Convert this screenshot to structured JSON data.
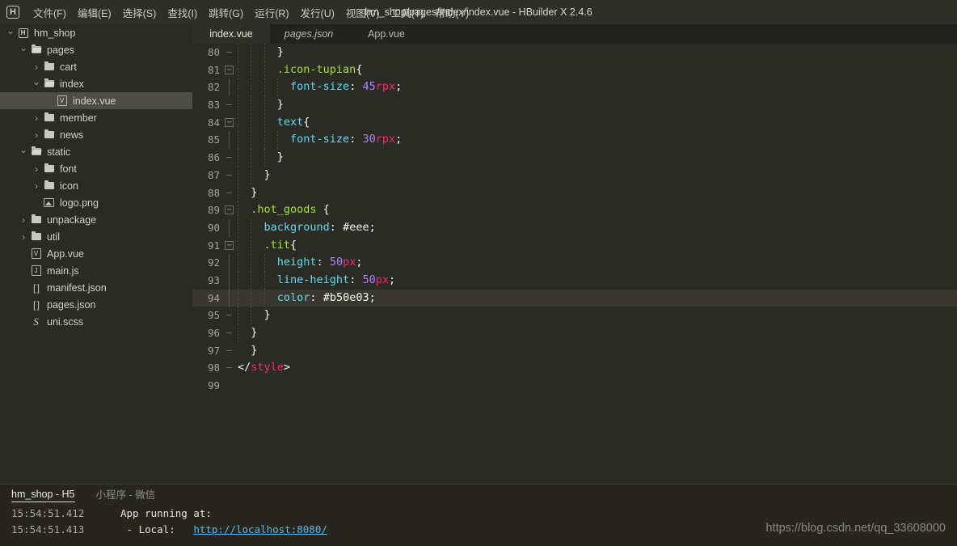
{
  "window": {
    "title": "hm_shop/pages/index/index.vue - HBuilder X 2.4.6",
    "logo": "H"
  },
  "menubar": {
    "items": [
      {
        "label": "文件(F)",
        "name": "menu-file"
      },
      {
        "label": "编辑(E)",
        "name": "menu-edit"
      },
      {
        "label": "选择(S)",
        "name": "menu-select"
      },
      {
        "label": "查找(I)",
        "name": "menu-find"
      },
      {
        "label": "跳转(G)",
        "name": "menu-goto"
      },
      {
        "label": "运行(R)",
        "name": "menu-run"
      },
      {
        "label": "发行(U)",
        "name": "menu-publish"
      },
      {
        "label": "视图(V)",
        "name": "menu-view"
      },
      {
        "label": "工具(T)",
        "name": "menu-tools"
      },
      {
        "label": "帮助(Y)",
        "name": "menu-help"
      }
    ]
  },
  "sidebar": {
    "items": [
      {
        "label": "hm_shop",
        "depth": 0,
        "twisty": "open",
        "icon": "project-icon",
        "selected": false
      },
      {
        "label": "pages",
        "depth": 1,
        "twisty": "open",
        "icon": "folder-open-icon",
        "selected": false
      },
      {
        "label": "cart",
        "depth": 2,
        "twisty": "closed",
        "icon": "folder-icon",
        "selected": false
      },
      {
        "label": "index",
        "depth": 2,
        "twisty": "open",
        "icon": "folder-open-icon",
        "selected": false
      },
      {
        "label": "index.vue",
        "depth": 3,
        "twisty": "none",
        "icon": "vue-file-icon",
        "selected": true
      },
      {
        "label": "member",
        "depth": 2,
        "twisty": "closed",
        "icon": "folder-icon",
        "selected": false
      },
      {
        "label": "news",
        "depth": 2,
        "twisty": "closed",
        "icon": "folder-icon",
        "selected": false
      },
      {
        "label": "static",
        "depth": 1,
        "twisty": "open",
        "icon": "folder-open-icon",
        "selected": false
      },
      {
        "label": "font",
        "depth": 2,
        "twisty": "closed",
        "icon": "folder-icon",
        "selected": false
      },
      {
        "label": "icon",
        "depth": 2,
        "twisty": "closed",
        "icon": "folder-icon",
        "selected": false
      },
      {
        "label": "logo.png",
        "depth": 2,
        "twisty": "none",
        "icon": "image-file-icon",
        "selected": false
      },
      {
        "label": "unpackage",
        "depth": 1,
        "twisty": "closed",
        "icon": "folder-icon",
        "selected": false
      },
      {
        "label": "util",
        "depth": 1,
        "twisty": "closed",
        "icon": "folder-icon",
        "selected": false
      },
      {
        "label": "App.vue",
        "depth": 1,
        "twisty": "none",
        "icon": "vue-file-icon",
        "selected": false
      },
      {
        "label": "main.js",
        "depth": 1,
        "twisty": "none",
        "icon": "js-file-icon",
        "selected": false
      },
      {
        "label": "manifest.json",
        "depth": 1,
        "twisty": "none",
        "icon": "json-file-icon",
        "selected": false
      },
      {
        "label": "pages.json",
        "depth": 1,
        "twisty": "none",
        "icon": "json-file-icon",
        "selected": false
      },
      {
        "label": "uni.scss",
        "depth": 1,
        "twisty": "none",
        "icon": "scss-file-icon",
        "selected": false
      }
    ]
  },
  "editor": {
    "tabs": [
      {
        "label": "index.vue",
        "active": true,
        "preview": false
      },
      {
        "label": "pages.json",
        "active": false,
        "preview": true
      },
      {
        "label": "App.vue",
        "active": false,
        "preview": false
      }
    ],
    "current_line": 94,
    "lines": [
      {
        "num": 80,
        "fold": "dash",
        "indent": 3,
        "tokens": [
          {
            "t": "      }",
            "c": "t-punct"
          }
        ]
      },
      {
        "num": 81,
        "fold": "box",
        "indent": 3,
        "tokens": [
          {
            "t": "      ",
            "c": "t-plain"
          },
          {
            "t": ".icon-tupian",
            "c": "t-sel"
          },
          {
            "t": "{",
            "c": "t-punct"
          }
        ]
      },
      {
        "num": 82,
        "fold": "bar",
        "indent": 4,
        "tokens": [
          {
            "t": "        ",
            "c": "t-plain"
          },
          {
            "t": "font-size",
            "c": "t-prop"
          },
          {
            "t": ": ",
            "c": "t-punct"
          },
          {
            "t": "45",
            "c": "t-num"
          },
          {
            "t": "rpx",
            "c": "t-unit"
          },
          {
            "t": ";",
            "c": "t-punct"
          }
        ]
      },
      {
        "num": 83,
        "fold": "dash",
        "indent": 3,
        "tokens": [
          {
            "t": "      }",
            "c": "t-punct"
          }
        ]
      },
      {
        "num": 84,
        "fold": "box",
        "indent": 3,
        "tokens": [
          {
            "t": "      ",
            "c": "t-plain"
          },
          {
            "t": "text",
            "c": "t-prop"
          },
          {
            "t": "{",
            "c": "t-punct"
          }
        ]
      },
      {
        "num": 85,
        "fold": "bar",
        "indent": 4,
        "tokens": [
          {
            "t": "        ",
            "c": "t-plain"
          },
          {
            "t": "font-size",
            "c": "t-prop"
          },
          {
            "t": ": ",
            "c": "t-punct"
          },
          {
            "t": "30",
            "c": "t-num"
          },
          {
            "t": "rpx",
            "c": "t-unit"
          },
          {
            "t": ";",
            "c": "t-punct"
          }
        ]
      },
      {
        "num": 86,
        "fold": "dash",
        "indent": 3,
        "tokens": [
          {
            "t": "      }",
            "c": "t-punct"
          }
        ]
      },
      {
        "num": 87,
        "fold": "dash",
        "indent": 2,
        "tokens": [
          {
            "t": "    }",
            "c": "t-punct"
          }
        ]
      },
      {
        "num": 88,
        "fold": "dash",
        "indent": 1,
        "tokens": [
          {
            "t": "  }",
            "c": "t-punct"
          }
        ]
      },
      {
        "num": 89,
        "fold": "box",
        "indent": 1,
        "tokens": [
          {
            "t": "  ",
            "c": "t-plain"
          },
          {
            "t": ".hot_goods",
            "c": "t-sel"
          },
          {
            "t": " {",
            "c": "t-punct"
          }
        ]
      },
      {
        "num": 90,
        "fold": "bar",
        "indent": 2,
        "tokens": [
          {
            "t": "    ",
            "c": "t-plain"
          },
          {
            "t": "background",
            "c": "t-prop"
          },
          {
            "t": ": ",
            "c": "t-punct"
          },
          {
            "t": "#eee",
            "c": "t-hex"
          },
          {
            "t": ";",
            "c": "t-punct"
          }
        ]
      },
      {
        "num": 91,
        "fold": "box",
        "indent": 2,
        "tokens": [
          {
            "t": "    ",
            "c": "t-plain"
          },
          {
            "t": ".tit",
            "c": "t-sel"
          },
          {
            "t": "{",
            "c": "t-punct"
          }
        ]
      },
      {
        "num": 92,
        "fold": "bar",
        "indent": 3,
        "tokens": [
          {
            "t": "      ",
            "c": "t-plain"
          },
          {
            "t": "height",
            "c": "t-prop"
          },
          {
            "t": ": ",
            "c": "t-punct"
          },
          {
            "t": "50",
            "c": "t-num"
          },
          {
            "t": "px",
            "c": "t-unit"
          },
          {
            "t": ";",
            "c": "t-punct"
          }
        ]
      },
      {
        "num": 93,
        "fold": "bar",
        "indent": 3,
        "tokens": [
          {
            "t": "      ",
            "c": "t-plain"
          },
          {
            "t": "line-height",
            "c": "t-prop"
          },
          {
            "t": ": ",
            "c": "t-punct"
          },
          {
            "t": "50",
            "c": "t-num"
          },
          {
            "t": "px",
            "c": "t-unit"
          },
          {
            "t": ";",
            "c": "t-punct"
          }
        ]
      },
      {
        "num": 94,
        "fold": "bar",
        "indent": 3,
        "tokens": [
          {
            "t": "      ",
            "c": "t-plain"
          },
          {
            "t": "color",
            "c": "t-prop"
          },
          {
            "t": ": ",
            "c": "t-punct"
          },
          {
            "t": "#b50e03",
            "c": "t-hex"
          },
          {
            "t": ";",
            "c": "t-punct"
          }
        ]
      },
      {
        "num": 95,
        "fold": "dash",
        "indent": 2,
        "tokens": [
          {
            "t": "    }",
            "c": "t-punct"
          }
        ]
      },
      {
        "num": 96,
        "fold": "dash",
        "indent": 1,
        "tokens": [
          {
            "t": "  }",
            "c": "t-punct"
          }
        ]
      },
      {
        "num": 97,
        "fold": "dash",
        "indent": 0,
        "tokens": [
          {
            "t": "  }",
            "c": "t-punct"
          }
        ]
      },
      {
        "num": 98,
        "fold": "dash",
        "indent": 0,
        "tokens": [
          {
            "t": "</",
            "c": "t-plain"
          },
          {
            "t": "style",
            "c": "t-tag"
          },
          {
            "t": ">",
            "c": "t-plain"
          }
        ]
      },
      {
        "num": 99,
        "fold": "none",
        "indent": 0,
        "tokens": []
      }
    ]
  },
  "console": {
    "tabs": [
      {
        "label": "hm_shop - H5",
        "active": true
      },
      {
        "label": "小程序 - 微信",
        "active": false
      }
    ],
    "logs": [
      {
        "time": "15:54:51.412",
        "text": "App running at:",
        "link": ""
      },
      {
        "time": "15:54:51.413",
        "text": " - Local:   ",
        "link": "http://localhost:8080/"
      }
    ]
  },
  "watermark": {
    "text": "https://blog.csdn.net/qq_33608000"
  },
  "colors": {
    "background": "#2b2b26",
    "menubar": "#2f2f2a",
    "tabbar": "#232320",
    "selection": "#4d4d42",
    "current_line": "#38382f",
    "selector": "#a6e22e",
    "property": "#66d9ef",
    "number": "#ae81ff",
    "unit": "#f92672",
    "link": "#5ab9e8"
  }
}
